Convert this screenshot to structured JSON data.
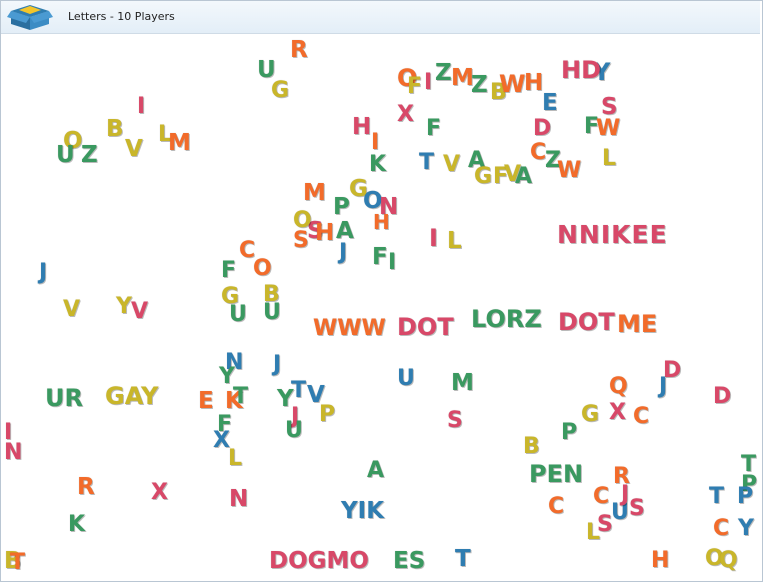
{
  "window": {
    "title": "Letters - 10 Players"
  },
  "icons": {
    "logo": "open-box-icon"
  },
  "palette": {
    "orange": "#f26b2a",
    "yellow": "#c9b62a",
    "green": "#3a9960",
    "blue": "#2f7db1",
    "pink": "#d84868"
  },
  "words": {
    "nnikee": "NNIKEE",
    "www": "WWW",
    "dot1": "DOT",
    "lorz": "LORZ",
    "dot2": "DOT",
    "me": "ME",
    "ur": "UR",
    "gay": "GAY",
    "dogmo": "DOGMO",
    "es": "ES",
    "yik": "YIK",
    "pen": "PEN",
    "hd": "HD",
    "uz": "UZ",
    "ug": "UG"
  },
  "tiles": {
    "t001": "R",
    "t002": "U",
    "t003": "G",
    "t004": "I",
    "t005": "O",
    "t006": "B",
    "t007": "V",
    "t008": "L",
    "t009": "M",
    "t010": "U",
    "t011": "Z",
    "t012": "O",
    "t013": "F",
    "t014": "I",
    "t015": "Z",
    "t016": "M",
    "t017": "Z",
    "t018": "B",
    "t019": "W",
    "t020": "H",
    "t021": "E",
    "t022": "Y",
    "t023": "S",
    "t024": "H",
    "t025": "I",
    "t026": "X",
    "t027": "F",
    "t028": "K",
    "t029": "T",
    "t030": "V",
    "t031": "A",
    "t032": "G",
    "t033": "F",
    "t034": "V",
    "t035": "A",
    "t036": "C",
    "t037": "Z",
    "t038": "W",
    "t039": "L",
    "t040": "D",
    "t041": "F",
    "t042": "W",
    "t043": "S",
    "t044": "M",
    "t045": "G",
    "t046": "P",
    "t047": "O",
    "t048": "N",
    "t049": "O",
    "t050": "S",
    "t051": "H",
    "t052": "A",
    "t053": "J",
    "t054": "F",
    "t055": "I",
    "t056": "I",
    "t057": "L",
    "t058": "H",
    "t059": "C",
    "t060": "O",
    "t061": "F",
    "t062": "G",
    "t063": "U",
    "t064": "B",
    "t065": "U",
    "t066": "J",
    "t067": "V",
    "t068": "Y",
    "t069": "V",
    "t070": "N",
    "t071": "Y",
    "t072": "J",
    "t073": "U",
    "t074": "M",
    "t075": "E",
    "t076": "K",
    "t077": "T",
    "t078": "F",
    "t079": "X",
    "t080": "Y",
    "t081": "T",
    "t082": "V",
    "t083": "P",
    "t084": "J",
    "t085": "U",
    "t086": "S",
    "t087": "D",
    "t088": "J",
    "t089": "D",
    "t090": "Q",
    "t091": "X",
    "t092": "G",
    "t093": "P",
    "t094": "C",
    "t095": "B",
    "t096": "I",
    "t097": "N",
    "t098": "L",
    "t099": "A",
    "t100": "R",
    "t101": "X",
    "t102": "N",
    "t103": "K",
    "t104": "C",
    "t105": "C",
    "t106": "R",
    "t107": "S",
    "t108": "U",
    "t109": "J",
    "t110": "L",
    "t111": "S",
    "t112": "T",
    "t113": "P",
    "t114": "T",
    "t115": "P",
    "t116": "C",
    "t117": "Y",
    "t118": "B",
    "t119": "T",
    "t120": "H",
    "t121": "O",
    "t122": "Q",
    "t123": "Y",
    "t124": "Z",
    "t125": "O",
    "t126": "H",
    "t127": "Q",
    "t128": "T",
    "t129": "X",
    "t130": "V"
  }
}
